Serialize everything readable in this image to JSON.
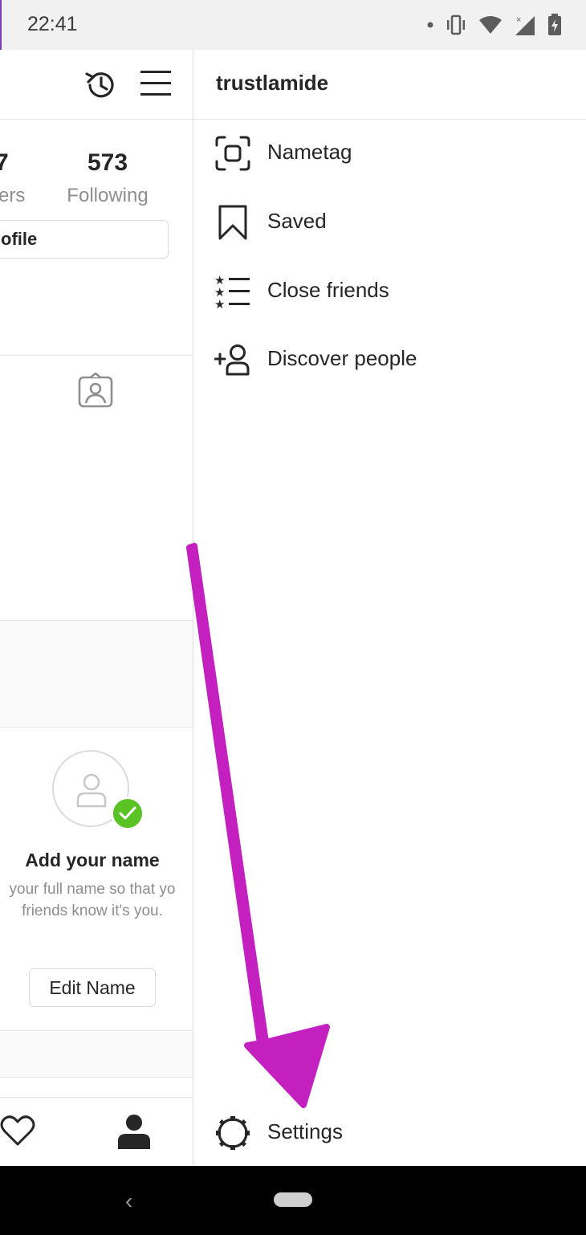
{
  "status_bar": {
    "time": "22:41",
    "icons": [
      "notification-dot-icon",
      "vibrate-icon",
      "wifi-icon",
      "signal-icon",
      "battery-charging-icon"
    ]
  },
  "profile_background": {
    "following_count": "573",
    "following_label": "Following",
    "followers_count_partial": "7",
    "followers_label_partial": "ers",
    "edit_profile_partial": "ofile",
    "suggestion_card": {
      "title": "Add your name",
      "description": "your full name so that yo friends know it's you.",
      "button_label": "Edit Name"
    }
  },
  "drawer": {
    "username": "trustlamide",
    "items": [
      {
        "label": "Nametag",
        "icon": "nametag-icon"
      },
      {
        "label": "Saved",
        "icon": "bookmark-icon"
      },
      {
        "label": "Close friends",
        "icon": "close-friends-icon"
      },
      {
        "label": "Discover people",
        "icon": "add-person-icon"
      }
    ],
    "settings_label": "Settings"
  },
  "colors": {
    "annotation_arrow": "#c41fbf",
    "check_badge": "#58c322",
    "nav_bar": "#000000"
  }
}
